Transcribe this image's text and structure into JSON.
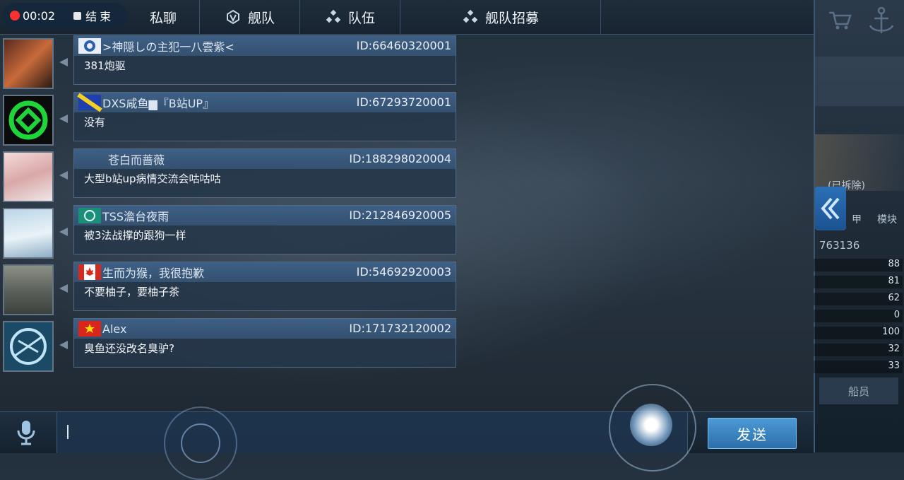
{
  "recording": {
    "time": "00:02",
    "stop_label": "结束"
  },
  "tabs": [
    {
      "label": "私聊",
      "icon": "none"
    },
    {
      "label": "舰队",
      "icon": "fleet-emblem-icon"
    },
    {
      "label": "队伍",
      "icon": "team-dots-icon"
    },
    {
      "label": "舰队招募",
      "icon": "recruit-dots-icon"
    }
  ],
  "messages": [
    {
      "name": ">神隠しの主犯一八雲紫<",
      "id": "ID:66460320001",
      "text": "381炮驱",
      "flag": "circle-emblem"
    },
    {
      "name": "DXS咸鱼▆『B站UP』",
      "id": "ID:67293720001",
      "text": "没有",
      "flag": "blue-yellow"
    },
    {
      "name": "苍白而蔷薇",
      "id": "ID:188298020004",
      "text": "大型b站up病情交流会咕咕咕",
      "flag": "none"
    },
    {
      "name": "TSS澹台夜雨",
      "id": "ID:212846920005",
      "text": "被3法战撑的跟狗一样",
      "flag": "teal-emblem"
    },
    {
      "name": "生而为猴，我很抱歉",
      "id": "ID:54692920003",
      "text": "不要柚子，要柚子茶",
      "flag": "canada"
    },
    {
      "name": "Alex",
      "id": "ID:171732120002",
      "text": "臭鱼还没改名臭驴?",
      "flag": "vietnam"
    }
  ],
  "input": {
    "value": "",
    "placeholder": ""
  },
  "send_label": "发送",
  "background_panel": {
    "number": "763136",
    "tabs": [
      "甲",
      "模块"
    ],
    "stats": [
      "88",
      "81",
      "62",
      "0",
      "100",
      "32",
      "33"
    ],
    "crew_label": "船员",
    "ship_status": "(已拆除)"
  }
}
